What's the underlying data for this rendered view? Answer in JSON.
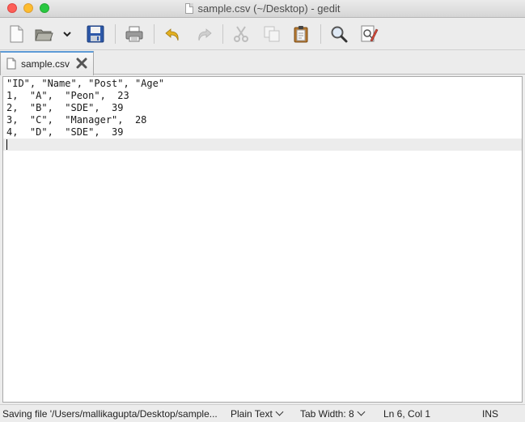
{
  "window": {
    "title": "sample.csv (~/Desktop) - gedit"
  },
  "toolbar": {
    "buttons": [
      {
        "name": "new-document",
        "icon": "new-document-icon"
      },
      {
        "name": "open",
        "icon": "folder-open-icon"
      },
      {
        "name": "open-recent",
        "icon": "chevron-down-icon"
      },
      {
        "name": "save",
        "icon": "floppy-disk-icon"
      },
      {
        "name": "print",
        "icon": "printer-icon"
      },
      {
        "name": "undo",
        "icon": "undo-arrow-icon"
      },
      {
        "name": "redo",
        "icon": "redo-arrow-icon"
      },
      {
        "name": "cut",
        "icon": "scissors-icon"
      },
      {
        "name": "copy",
        "icon": "copy-icon"
      },
      {
        "name": "paste",
        "icon": "clipboard-icon"
      },
      {
        "name": "find",
        "icon": "magnifier-icon"
      },
      {
        "name": "find-replace",
        "icon": "find-replace-icon"
      }
    ]
  },
  "tabs": [
    {
      "label": "sample.csv",
      "active": true
    }
  ],
  "editor": {
    "lines": [
      "\"ID\", \"Name\", \"Post\", \"Age\"",
      "1,  \"A\",  \"Peon\",  23",
      "2,  \"B\",  \"SDE\",  39",
      "3,  \"C\",  \"Manager\",  28",
      "4,  \"D\",  \"SDE\",  39",
      ""
    ],
    "current_line": 6
  },
  "statusbar": {
    "message": "Saving file '/Users/mallikagupta/Desktop/sample...",
    "language": "Plain Text",
    "tab_width": "Tab Width:  8",
    "position": "Ln 6, Col 1",
    "mode": "INS"
  }
}
